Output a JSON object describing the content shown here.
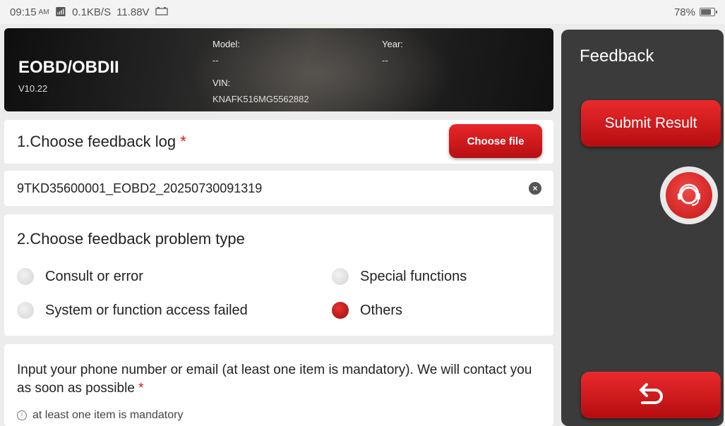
{
  "status_bar": {
    "time": "09:15",
    "ampm": "AM",
    "network_speed": "0.1KB/S",
    "voltage": "11.88V",
    "battery_percent": "78%",
    "battery_level": 0.78
  },
  "header": {
    "app_title": "EOBD/OBDII",
    "version": "V10.22",
    "model_label": "Model:",
    "model_value": "--",
    "year_label": "Year:",
    "year_value": "--",
    "vin_label": "VIN:",
    "vin_value": "KNAFK516MG5562882"
  },
  "feedback_log": {
    "title": "1.Choose feedback log",
    "required_mark": "*",
    "choose_button": "Choose file",
    "selected_file": "9TKD35600001_EOBD2_20250730091319"
  },
  "problem_type": {
    "title": "2.Choose feedback problem type",
    "options": [
      {
        "label": "Consult or error",
        "checked": false
      },
      {
        "label": "Special functions",
        "checked": false
      },
      {
        "label": "System or function access failed",
        "checked": false
      },
      {
        "label": "Others",
        "checked": true
      }
    ]
  },
  "contact": {
    "text": "Input your phone number or email (at least one item is mandatory). We will contact you as soon as possible",
    "required_mark": "*",
    "hint": "at least one item is mandatory"
  },
  "side_panel": {
    "title": "Feedback",
    "submit_button": "Submit Result",
    "support_icon": "customer-support-icon",
    "back_icon": "return-arrow-icon"
  },
  "colors": {
    "accent_red": "#d11a1a",
    "panel_bg": "#3b3b3b"
  }
}
